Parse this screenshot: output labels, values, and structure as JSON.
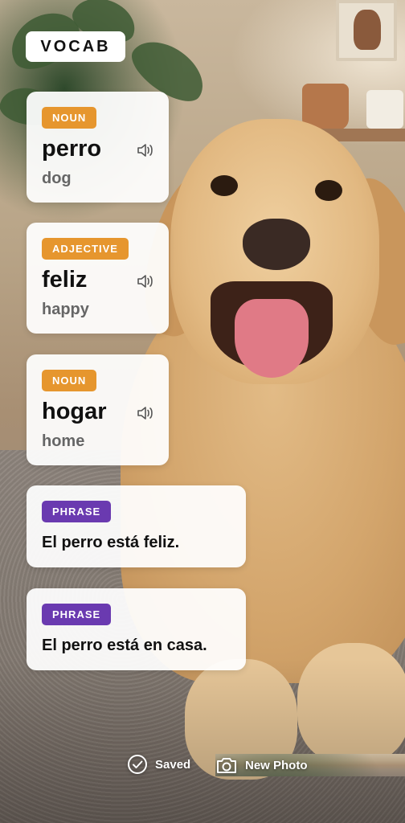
{
  "app": {
    "badge": "VOCAB"
  },
  "cards": [
    {
      "tag": "NOUN",
      "word": "perro",
      "translation": "dog"
    },
    {
      "tag": "ADJECTIVE",
      "word": "feliz",
      "translation": "happy"
    },
    {
      "tag": "NOUN",
      "word": "hogar",
      "translation": "home"
    }
  ],
  "phrases": [
    {
      "tag": "PHRASE",
      "text": "El perro está feliz."
    },
    {
      "tag": "PHRASE",
      "text": "El perro está en casa."
    }
  ],
  "actions": {
    "saved": "Saved",
    "new_photo": "New Photo"
  },
  "colors": {
    "tag_word": "#e6962e",
    "tag_phrase": "#6a3ab0",
    "card_bg": "#ffffff"
  },
  "icons": {
    "speaker": "speaker-icon",
    "saved": "check-circle-icon",
    "new_photo": "camera-icon"
  }
}
